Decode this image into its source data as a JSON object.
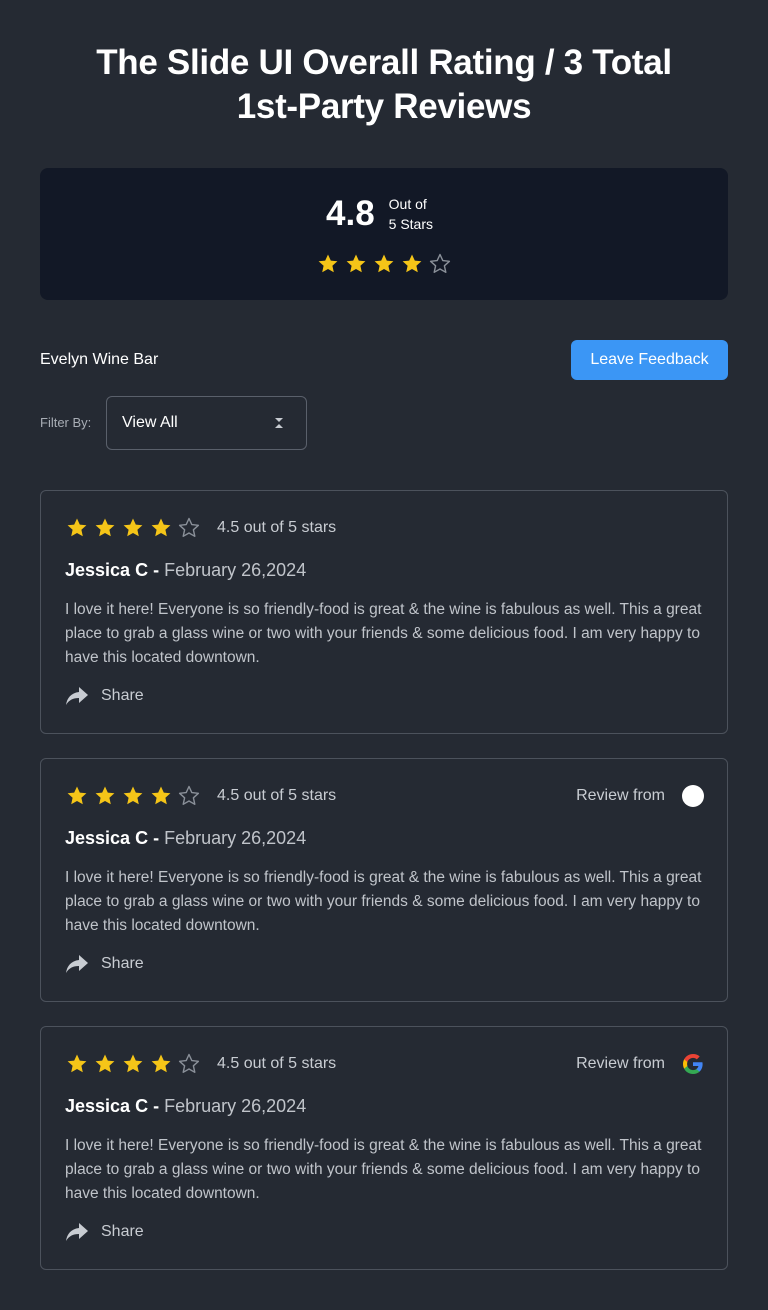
{
  "page": {
    "title": "The Slide UI Overall Rating / 3 Total 1st-Party Reviews"
  },
  "summary": {
    "score": "4.8",
    "out_of_line1": "Out of",
    "out_of_line2": "5 Stars",
    "stars_filled": 4,
    "stars_total": 5
  },
  "business": {
    "name": "Evelyn Wine Bar"
  },
  "actions": {
    "leave_feedback": "Leave Feedback"
  },
  "filter": {
    "label": "Filter By:",
    "selected": "View All"
  },
  "reviews": [
    {
      "rating_text": "4.5 out of 5 stars",
      "stars_filled": 4,
      "reviewer": "Jessica C",
      "separator": "-",
      "date": "February 26,2024",
      "text": "I love it here! Everyone is so friendly-food is great & the wine is fabulous as well. This a great place to grab a glass wine or two with your friends & some delicious food. I am very happy to have this located downtown.",
      "share_label": "Share",
      "source_label": "",
      "source_icon": "none"
    },
    {
      "rating_text": "4.5 out of 5 stars",
      "stars_filled": 4,
      "reviewer": "Jessica C",
      "separator": "-",
      "date": "February 26,2024",
      "text": "I love it here! Everyone is so friendly-food is great & the wine is fabulous as well. This a great place to grab a glass wine or two with your friends & some delicious food. I am very happy to have this located downtown.",
      "share_label": "Share",
      "source_label": "Review from",
      "source_icon": "white-circle-icon"
    },
    {
      "rating_text": "4.5 out of 5 stars",
      "stars_filled": 4,
      "reviewer": "Jessica C",
      "separator": "-",
      "date": "February 26,2024",
      "text": "I love it here! Everyone is so friendly-food is great & the wine is fabulous as well. This a great place to grab a glass wine or two with your friends & some delicious food. I am very happy to have this located downtown.",
      "share_label": "Share",
      "source_label": "Review from",
      "source_icon": "google-icon"
    }
  ],
  "colors": {
    "background": "#252a33",
    "summary_card": "#121826",
    "accent_button": "#3b96f5",
    "star_filled": "#f5c518",
    "star_empty": "#8a9099"
  }
}
